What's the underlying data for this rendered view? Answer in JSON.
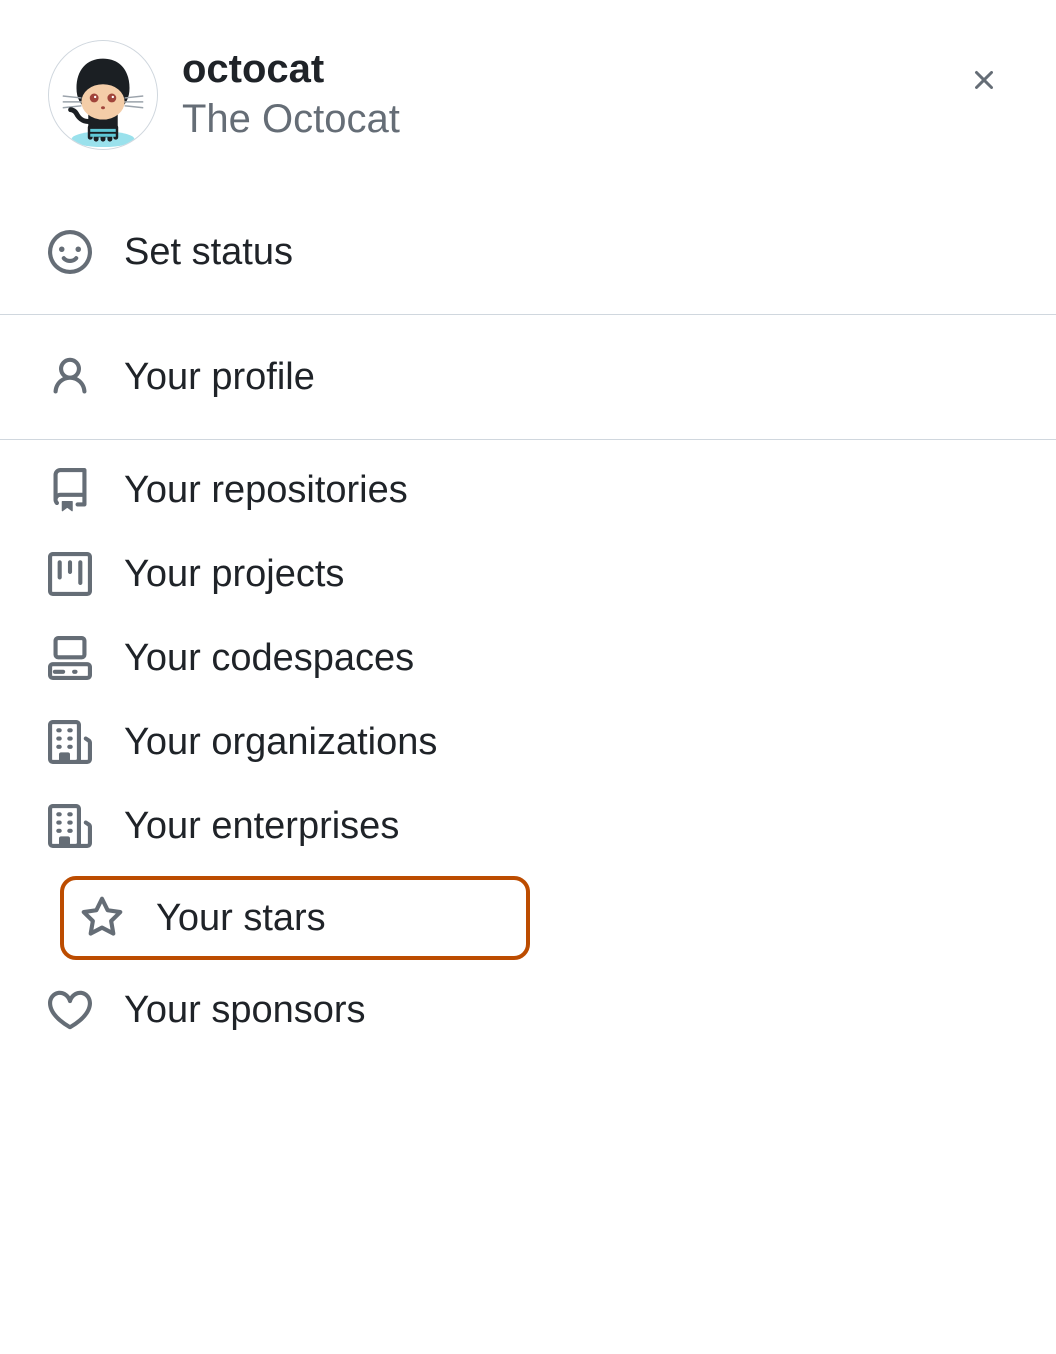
{
  "user": {
    "username": "octocat",
    "fullname": "The Octocat"
  },
  "status": {
    "label": "Set status"
  },
  "menu": {
    "profile": "Your profile",
    "repositories": "Your repositories",
    "projects": "Your projects",
    "codespaces": "Your codespaces",
    "organizations": "Your organizations",
    "enterprises": "Your enterprises",
    "stars": "Your stars",
    "sponsors": "Your sponsors"
  },
  "highlight_color": "#bc4c00"
}
